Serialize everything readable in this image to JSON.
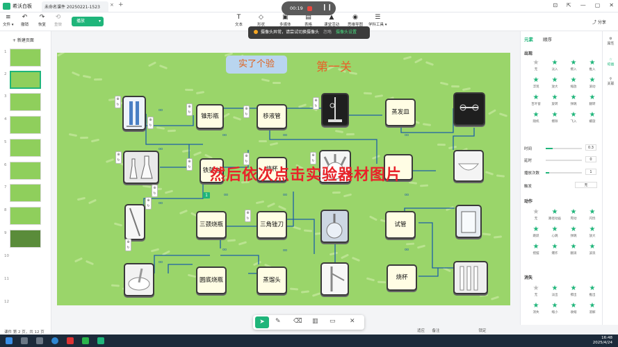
{
  "app": {
    "name": "希沃白板",
    "doc_tab": "未命名课件 20250221-1523",
    "tab_close": "×",
    "tab_add": "+"
  },
  "window_controls": [
    "⊡",
    "⇱",
    "—",
    "▢",
    "✕"
  ],
  "recording": {
    "time": "00:19"
  },
  "toolbar": {
    "left": [
      {
        "icon": "≡",
        "label": "文件 ▾"
      },
      {
        "icon": "↶",
        "label": "撤销"
      },
      {
        "icon": "↷",
        "label": "恢复"
      },
      {
        "icon": "⟲",
        "label": "重做"
      }
    ],
    "play": "播放",
    "play_dd": "▾",
    "center": [
      {
        "icon": "T",
        "label": "文本"
      },
      {
        "icon": "◇",
        "label": "形状"
      },
      {
        "icon": "▣",
        "label": "多媒体"
      },
      {
        "icon": "▤",
        "label": "表格"
      },
      {
        "icon": "▲",
        "label": "课堂活动"
      },
      {
        "icon": "◉",
        "label": "思维导图"
      },
      {
        "icon": "☰",
        "label": "学科工具 ▾"
      }
    ],
    "share": "分享"
  },
  "toast": {
    "message": "摄像头异常，请尝试切换摄像头",
    "ignore": "忽略",
    "action": "摄像头设置"
  },
  "slides": {
    "new_page": "+ 新建页面",
    "numbers": [
      "1",
      "2",
      "3",
      "4",
      "5",
      "6",
      "7",
      "8",
      "9",
      "10",
      "11",
      "12"
    ]
  },
  "statusbar": {
    "page": "课件 第 2 页，共 12 页",
    "zoom": "适应",
    "notes": "备注",
    "locked": "锁定"
  },
  "stage": {
    "tag": "实了个验",
    "level": "第一关",
    "banner": "然后依次点击实验器材图片",
    "labels": [
      "锥形瓶",
      "移液管",
      "蒸发皿",
      "铁架台",
      "烧杯",
      "三颈烧瓶",
      "三角锉刀",
      "试管",
      "圆底烧瓶",
      "蒸馏头",
      "烧杯"
    ],
    "num_tag": "1"
  },
  "panel": {
    "tabs": [
      "元素",
      "顺序"
    ],
    "sections": {
      "enter": "出现",
      "action": "动作",
      "exit": "消失"
    },
    "enter_effects": [
      "无",
      "淡入",
      "擦入",
      "推入",
      "浮现",
      "放大",
      "缩放",
      "滚动",
      "百叶窗",
      "旋转",
      "弹跳",
      "翻转",
      "随机",
      "擦除",
      "飞入",
      "螺旋"
    ],
    "action_effects": [
      "无",
      "路径动画",
      "晃动",
      "闪烁",
      "跳跃",
      "心跳",
      "弹跳",
      "放大",
      "摇摆",
      "爆炸",
      "翻滚",
      "波浪"
    ],
    "exit_effects": [
      "无",
      "淡出",
      "擦出",
      "推出",
      "消失",
      "缩小",
      "收缩",
      "溶解"
    ],
    "props": [
      {
        "label": "时间",
        "value": "0.3"
      },
      {
        "label": "延时",
        "value": "0"
      },
      {
        "label": "播放次数",
        "value": "1"
      }
    ],
    "trigger": {
      "label": "触发",
      "value": "无"
    }
  },
  "right_rail": [
    "属性",
    "动画",
    "关联"
  ],
  "taskbar": {
    "time": "16:48",
    "date": "2025/4/24"
  }
}
